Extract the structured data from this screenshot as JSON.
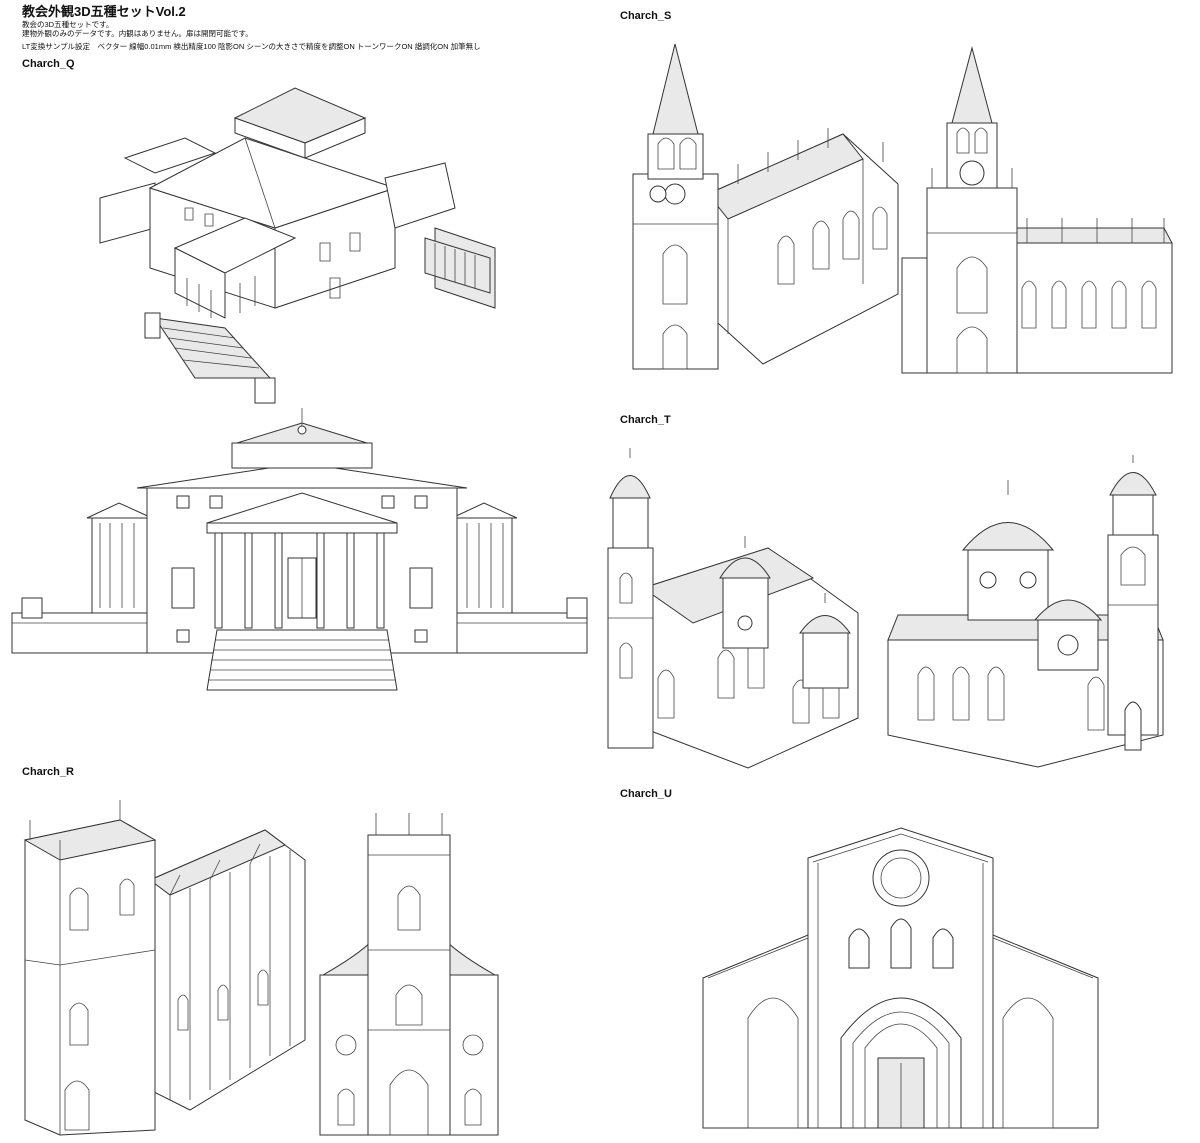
{
  "header": {
    "title": "教会外観3D五種セットVol.2",
    "line1": "教会の3D五種セットです。",
    "line2": "建物外観のみのデータです。内観はありません。扉は開閉可能です。",
    "settings": "LT変換サンプル設定　ベクター 線幅0.01mm 検出精度100 陰影ON シーンの大きさで精度を調整ON トーンワークON 諧調化ON 加筆無し"
  },
  "labels": {
    "q": "Charch_Q",
    "r": "Charch_R",
    "s": "Charch_S",
    "t": "Charch_T",
    "u": "Charch_U"
  }
}
